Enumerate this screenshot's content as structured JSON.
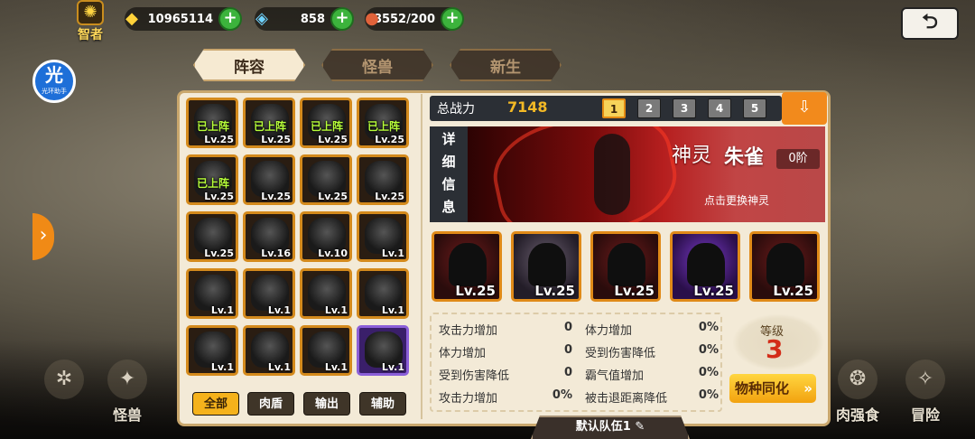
{
  "top": {
    "rank": "智者",
    "gold": "10965114",
    "diamond": "858",
    "stamina": "8552/200"
  },
  "guide_badge": {
    "title": "光",
    "sub": "光环助手"
  },
  "tabs": [
    "阵容",
    "怪兽",
    "新生"
  ],
  "roster": [
    {
      "level": "Lv.25",
      "deployed": "已上阵"
    },
    {
      "level": "Lv.25",
      "deployed": "已上阵"
    },
    {
      "level": "Lv.25",
      "deployed": "已上阵"
    },
    {
      "level": "Lv.25",
      "deployed": "已上阵"
    },
    {
      "level": "Lv.25",
      "deployed": "已上阵"
    },
    {
      "level": "Lv.25",
      "deployed": ""
    },
    {
      "level": "Lv.25",
      "deployed": ""
    },
    {
      "level": "Lv.25",
      "deployed": ""
    },
    {
      "level": "Lv.25",
      "deployed": ""
    },
    {
      "level": "Lv.16",
      "deployed": ""
    },
    {
      "level": "Lv.10",
      "deployed": ""
    },
    {
      "level": "Lv.1",
      "deployed": ""
    },
    {
      "level": "Lv.1",
      "deployed": ""
    },
    {
      "level": "Lv.1",
      "deployed": ""
    },
    {
      "level": "Lv.1",
      "deployed": ""
    },
    {
      "level": "Lv.1",
      "deployed": ""
    },
    {
      "level": "Lv.1",
      "deployed": ""
    },
    {
      "level": "Lv.1",
      "deployed": ""
    },
    {
      "level": "Lv.1",
      "deployed": ""
    },
    {
      "level": "Lv.1",
      "deployed": ""
    }
  ],
  "filters": [
    "全部",
    "肉盾",
    "输出",
    "辅助"
  ],
  "power": {
    "label": "总战力",
    "value": "7148"
  },
  "teams": [
    "1",
    "2",
    "3",
    "4",
    "5"
  ],
  "detail_tab": [
    "详",
    "细",
    "信",
    "息"
  ],
  "deity": {
    "type": "神灵",
    "name": "朱雀",
    "stage": "0阶",
    "hint": "点击更换神灵"
  },
  "lineup": [
    "Lv.25",
    "Lv.25",
    "Lv.25",
    "Lv.25",
    "Lv.25"
  ],
  "stats_left": [
    {
      "label": "攻击力增加",
      "value": "0"
    },
    {
      "label": "体力增加",
      "value": "0"
    },
    {
      "label": "受到伤害降低",
      "value": "0"
    },
    {
      "label": "攻击力增加",
      "value": "0%"
    }
  ],
  "stats_right": [
    {
      "label": "体力增加",
      "value": "0%"
    },
    {
      "label": "受到伤害降低",
      "value": "0%"
    },
    {
      "label": "霸气值增加",
      "value": "0%"
    },
    {
      "label": "被击退距离降低",
      "value": "0%"
    }
  ],
  "level": {
    "label": "等级",
    "value": "3"
  },
  "assimilate": "物种同化",
  "team_name": "默认队伍1",
  "bottom_nav": {
    "left": "怪兽",
    "right1": "肉强食",
    "right2": "冒险"
  }
}
